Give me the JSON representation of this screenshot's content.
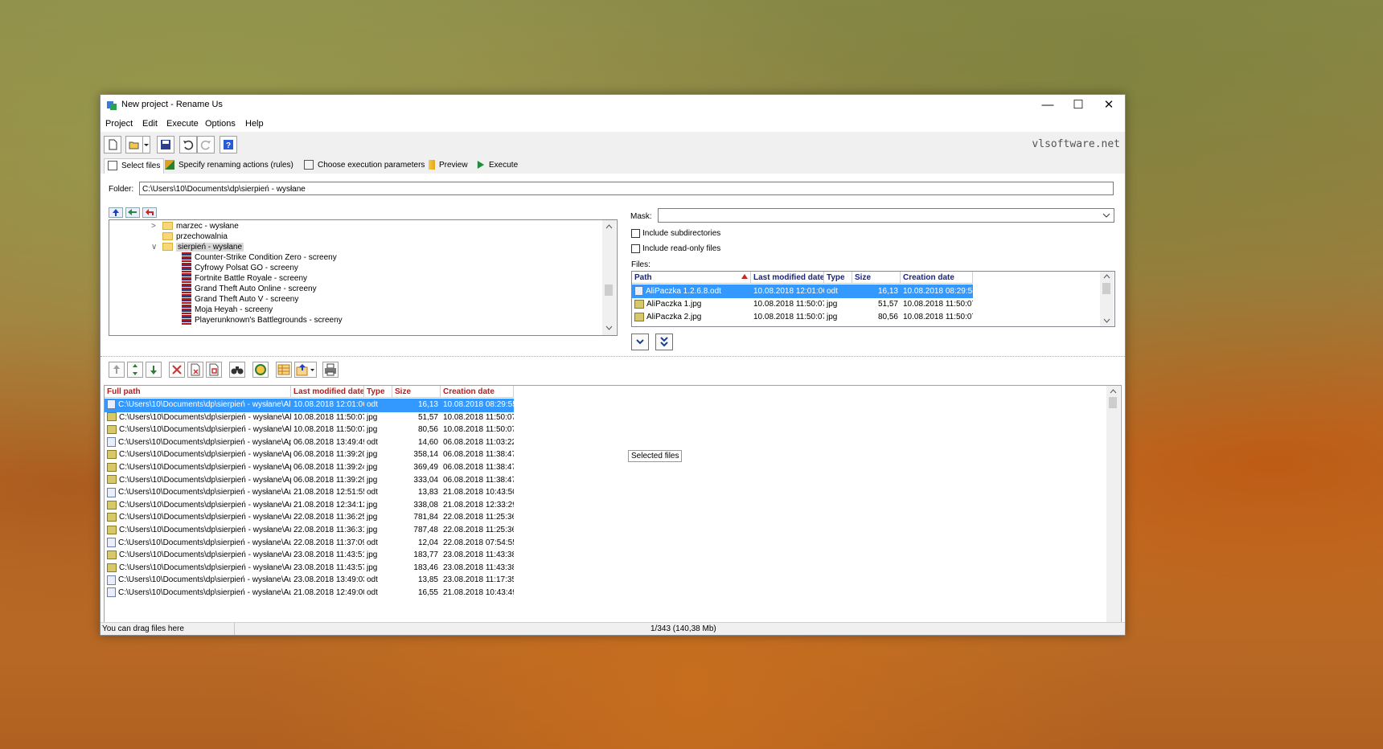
{
  "window": {
    "title": "New project - Rename Us",
    "controls": {
      "minimize": "—",
      "maximize": "☐",
      "close": "✕"
    }
  },
  "menu": [
    "Project",
    "Edit",
    "Execute",
    "Options",
    "Help"
  ],
  "toolbar": {
    "brand": "vlsoftware.net",
    "buttons": [
      "new-icon",
      "open-icon",
      "dropdown-icon",
      "save-icon",
      "undo-icon",
      "redo-icon",
      "help-icon"
    ]
  },
  "tabs": [
    "Select files",
    "Specify renaming actions (rules)",
    "Choose execution parameters",
    "Preview",
    "Execute"
  ],
  "folder": {
    "label": "Folder:",
    "value": "C:\\Users\\10\\Documents\\dp\\sierpień - wysłane"
  },
  "tree": {
    "items": [
      {
        "label": "marzec - wysłane",
        "kind": "folder",
        "expander": ">"
      },
      {
        "label": "przechowalnia",
        "kind": "folder",
        "expander": ""
      },
      {
        "label": "sierpień - wysłane",
        "kind": "folder",
        "expander": "∨"
      },
      {
        "label": "Counter-Strike Condition Zero - screeny",
        "kind": "book"
      },
      {
        "label": "Cyfrowy Polsat GO - screeny",
        "kind": "book"
      },
      {
        "label": "Fortnite Battle Royale - screeny",
        "kind": "book"
      },
      {
        "label": "Grand Theft Auto Online - screeny",
        "kind": "book"
      },
      {
        "label": "Grand Theft Auto V - screeny",
        "kind": "book"
      },
      {
        "label": "Moja Heyah - screeny",
        "kind": "book"
      },
      {
        "label": "Playerunknown's Battlegrounds - screeny",
        "kind": "book"
      }
    ]
  },
  "mask": {
    "label": "Mask:",
    "value": ""
  },
  "options": {
    "include_subdirectories": "Include subdirectories",
    "include_readonly": "Include read-only files",
    "files_label": "Files:"
  },
  "files": {
    "columns": [
      "Path",
      "Last modified date",
      "Type",
      "Size",
      "Creation date"
    ],
    "rows": [
      [
        "AliPaczka 1.2.6.8.odt",
        "10.08.2018 12:01:06",
        "odt",
        "16,13",
        "10.08.2018 08:29:55"
      ],
      [
        "AliPaczka 1.jpg",
        "10.08.2018 11:50:07",
        "jpg",
        "51,57",
        "10.08.2018 11:50:07"
      ],
      [
        "AliPaczka 2.jpg",
        "10.08.2018 11:50:07",
        "jpg",
        "80,56",
        "10.08.2018 11:50:07"
      ]
    ]
  },
  "grid": {
    "columns": [
      "Full path",
      "Last modified date",
      "Type",
      "Size",
      "Creation date"
    ],
    "rows": [
      [
        "C:\\Users\\10\\Documents\\dp\\sierpień - wysłane\\AliPacz",
        "10.08.2018 12:01:06",
        "odt",
        "16,13",
        "10.08.2018 08:29:55"
      ],
      [
        "C:\\Users\\10\\Documents\\dp\\sierpień - wysłane\\AliPacz",
        "10.08.2018 11:50:07",
        "jpg",
        "51,57",
        "10.08.2018 11:50:07"
      ],
      [
        "C:\\Users\\10\\Documents\\dp\\sierpień - wysłane\\AliPacz",
        "10.08.2018 11:50:07",
        "jpg",
        "80,56",
        "10.08.2018 11:50:07"
      ],
      [
        "C:\\Users\\10\\Documents\\dp\\sierpień - wysłane\\Appy T",
        "06.08.2018 13:49:49",
        "odt",
        "14,60",
        "06.08.2018 11:03:22"
      ],
      [
        "C:\\Users\\10\\Documents\\dp\\sierpień - wysłane\\Appy T",
        "06.08.2018 11:39:20",
        "jpg",
        "358,14",
        "06.08.2018 11:38:47"
      ],
      [
        "C:\\Users\\10\\Documents\\dp\\sierpień - wysłane\\Appy T",
        "06.08.2018 11:39:24",
        "jpg",
        "369,49",
        "06.08.2018 11:38:47"
      ],
      [
        "C:\\Users\\10\\Documents\\dp\\sierpień - wysłane\\Appy T",
        "06.08.2018 11:39:29",
        "jpg",
        "333,04",
        "06.08.2018 11:38:47"
      ],
      [
        "C:\\Users\\10\\Documents\\dp\\sierpień - wysłane\\AutoC/",
        "21.08.2018 12:51:55",
        "odt",
        "13,83",
        "21.08.2018 10:43:50"
      ],
      [
        "C:\\Users\\10\\Documents\\dp\\sierpień - wysłane\\AutoC/",
        "21.08.2018 12:34:12",
        "jpg",
        "338,08",
        "21.08.2018 12:33:29"
      ],
      [
        "C:\\Users\\10\\Documents\\dp\\sierpień - wysłane\\AutoD\\",
        "22.08.2018 11:36:25",
        "jpg",
        "781,84",
        "22.08.2018 11:25:36"
      ],
      [
        "C:\\Users\\10\\Documents\\dp\\sierpień - wysłane\\AutoD\\",
        "22.08.2018 11:36:31",
        "jpg",
        "787,48",
        "22.08.2018 11:25:36"
      ],
      [
        "C:\\Users\\10\\Documents\\dp\\sierpień - wysłane\\AutoD\\",
        "22.08.2018 11:37:09",
        "odt",
        "12,04",
        "22.08.2018 07:54:55"
      ],
      [
        "C:\\Users\\10\\Documents\\dp\\sierpień - wysłane\\AutoD\\",
        "23.08.2018 11:43:51",
        "jpg",
        "183,77",
        "23.08.2018 11:43:38"
      ],
      [
        "C:\\Users\\10\\Documents\\dp\\sierpień - wysłane\\AutoD\\",
        "23.08.2018 11:43:57",
        "jpg",
        "183,46",
        "23.08.2018 11:43:38"
      ],
      [
        "C:\\Users\\10\\Documents\\dp\\sierpień - wysłane\\AutoD\\",
        "23.08.2018 13:49:03",
        "odt",
        "13,85",
        "23.08.2018 11:17:35"
      ],
      [
        "C:\\Users\\10\\Documents\\dp\\sierpień - wysłane\\AutoD\\",
        "21.08.2018 12:49:00",
        "odt",
        "16,55",
        "21.08.2018 10:43:49"
      ]
    ],
    "selected_files_button": "Selected files"
  },
  "status": {
    "left": "You can drag files here",
    "center": "1/343  (140,38 Mb)"
  },
  "colors": {
    "selection": "#3399ff",
    "header_text": "#1a237e",
    "grid_header_text": "#b71c1c"
  }
}
